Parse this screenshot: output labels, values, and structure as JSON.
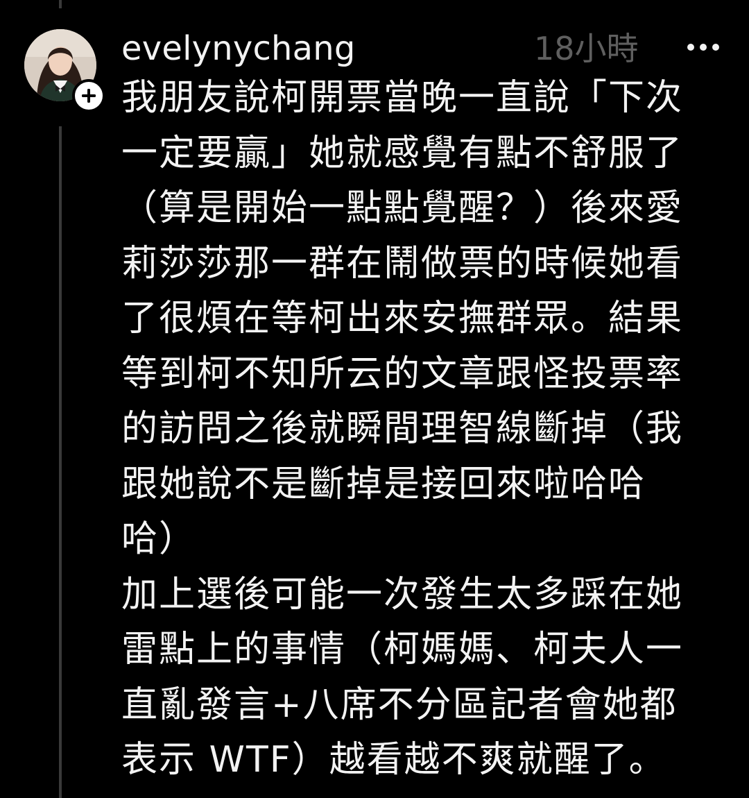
{
  "post": {
    "username": "evelynychang",
    "timestamp": "18小時",
    "lines": [
      "我朋友說柯開票當晚一直說「下次",
      "一定要贏」她就感覺有點不舒服了",
      "（算是開始一點點覺醒？）後來愛",
      "莉莎莎那一群在鬧做票的時候她看",
      "了很煩在等柯出來安撫群眾。結果",
      "等到柯不知所云的文章跟怪投票率",
      "的訪問之後就瞬間理智線斷掉（我",
      "跟她說不是斷掉是接回來啦哈哈",
      "哈）",
      "加上選後可能一次發生太多踩在她",
      "雷點上的事情（柯媽媽、柯夫人一",
      "直亂發言+八席不分區記者會她都",
      "表示 WTF）越看越不爽就醒了。"
    ]
  },
  "icons": {
    "avatar": "profile-avatar",
    "follow": "plus-icon",
    "more": "more-horizontal-icon"
  },
  "colors": {
    "background": "#000000",
    "text": "#f3f3f3",
    "muted": "#5f5f5f",
    "thread_line": "#3a3a3a"
  }
}
